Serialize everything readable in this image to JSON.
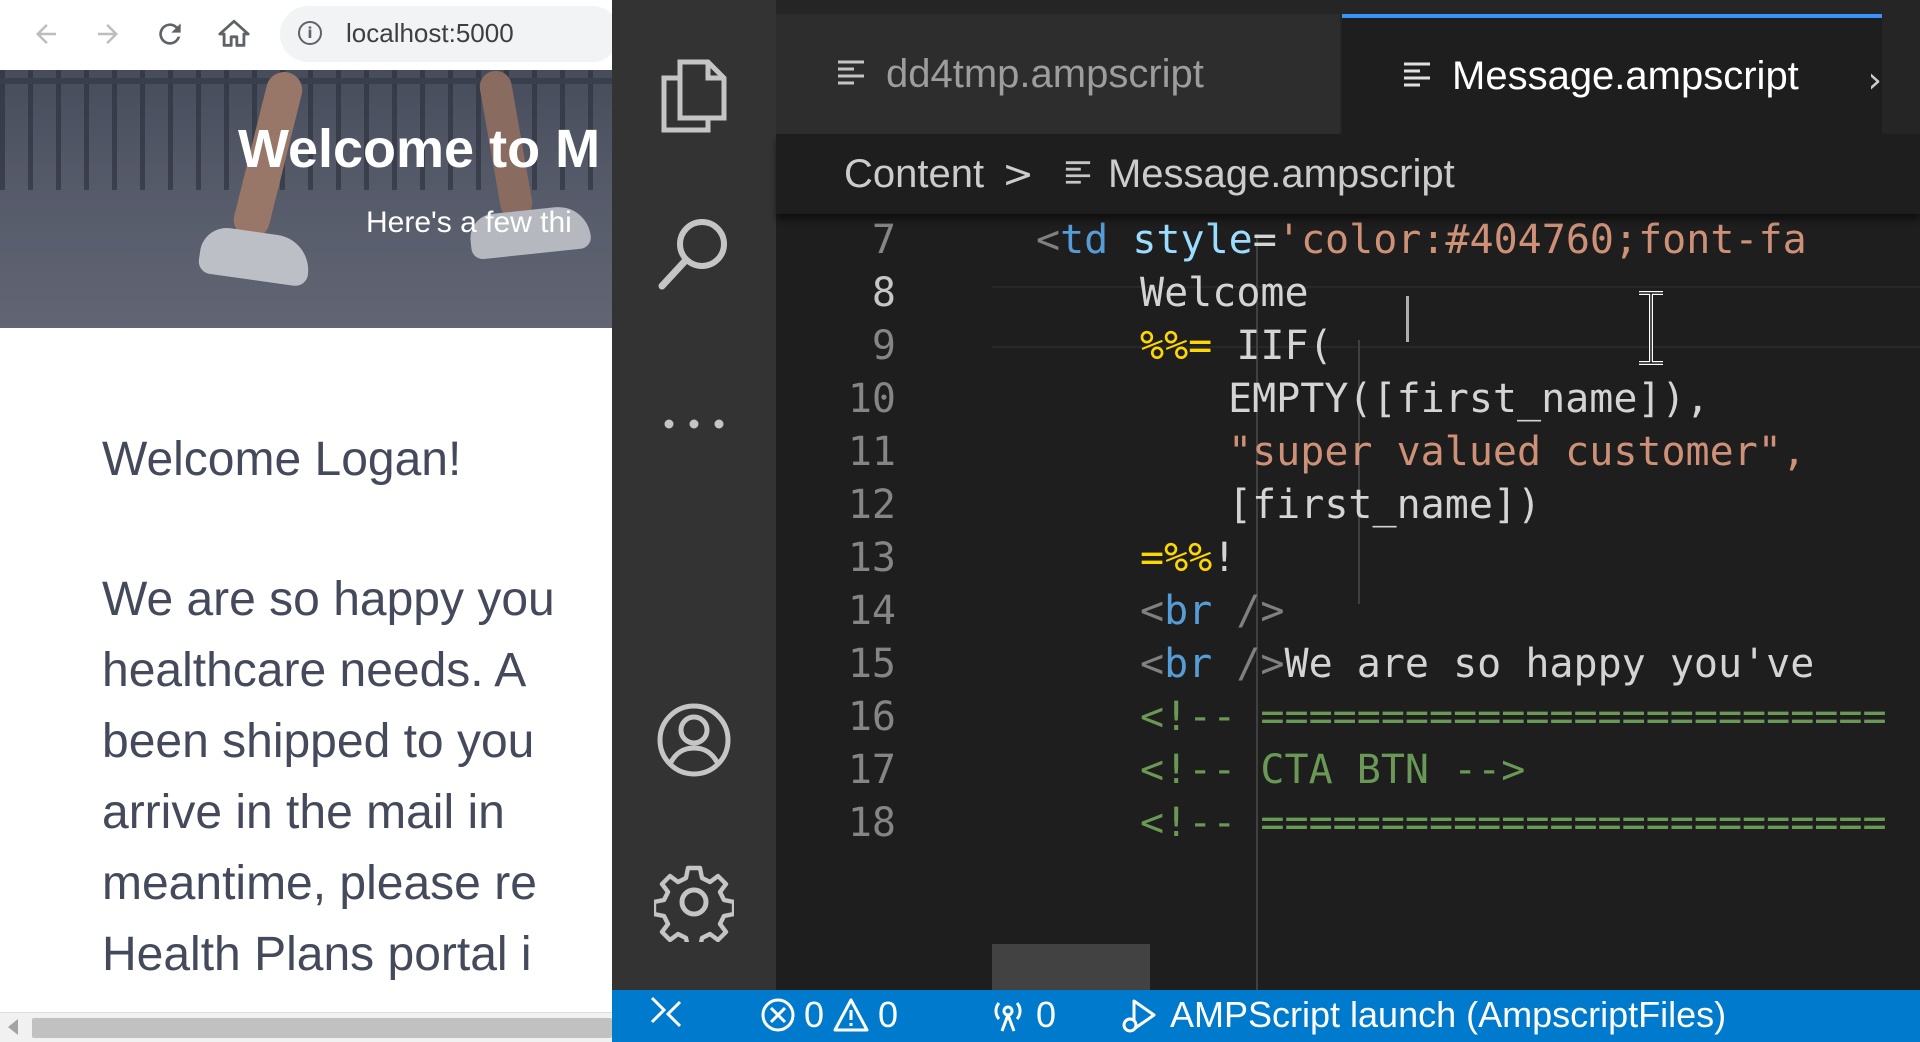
{
  "browser": {
    "url": "localhost:5000",
    "hero": {
      "title": "Welcome to M",
      "subtitle": "Here's a few thi"
    },
    "greeting": "Welcome Logan!",
    "body_lines": [
      "We are so happy you",
      "healthcare needs. A",
      "been shipped to you",
      "arrive in the mail in",
      "meantime, please re",
      "Health Plans portal i"
    ]
  },
  "vscode": {
    "tabs": [
      {
        "label": "dd4tmp.ampscript",
        "active": false
      },
      {
        "label": "Message.ampscript",
        "active": true
      }
    ],
    "tab_close": "›",
    "tab_actions": "⋮",
    "breadcrumb": {
      "folder": "Content",
      "separator": ">",
      "file": "Message.ampscript"
    },
    "editor": {
      "active_line": 8,
      "line_numbers": [
        "7",
        "8",
        "9",
        "10",
        "11",
        "12",
        "13",
        "14",
        "15",
        "16",
        "17",
        "18"
      ],
      "lines": [
        [
          {
            "t": "<",
            "c": "tk-punc"
          },
          {
            "t": "td",
            "c": "tk-tag"
          },
          {
            "t": " style",
            "c": "tk-attr"
          },
          {
            "t": "=",
            "c": "tk-txt"
          },
          {
            "t": "'color:#404760;font-fa",
            "c": "tk-str"
          }
        ],
        [
          {
            "t": "Welcome ",
            "c": "tk-txt"
          }
        ],
        [
          {
            "t": "%%=",
            "c": "tk-amp2"
          },
          {
            "t": " IIF(",
            "c": "tk-txt"
          }
        ],
        [
          {
            "t": "EMPTY([first_name]),",
            "c": "tk-txt"
          }
        ],
        [
          {
            "t": "\"super valued customer\",",
            "c": "tk-str"
          }
        ],
        [
          {
            "t": "[first_name])",
            "c": "tk-txt"
          }
        ],
        [
          {
            "t": "=%%",
            "c": "tk-amp2"
          },
          {
            "t": "!",
            "c": "tk-txt"
          }
        ],
        [
          {
            "t": "<",
            "c": "tk-punc"
          },
          {
            "t": "br",
            "c": "tk-tag"
          },
          {
            "t": " />",
            "c": "tk-punc"
          }
        ],
        [
          {
            "t": "<",
            "c": "tk-punc"
          },
          {
            "t": "br",
            "c": "tk-tag"
          },
          {
            "t": " />",
            "c": "tk-punc"
          },
          {
            "t": "We are so happy you've",
            "c": "tk-txt"
          }
        ],
        [
          {
            "t": "<!-- ==========================",
            "c": "tk-com"
          }
        ],
        [
          {
            "t": "<!-- CTA BTN -->",
            "c": "tk-com"
          }
        ],
        [
          {
            "t": "<!-- ==========================",
            "c": "tk-com"
          }
        ]
      ]
    },
    "status_bar": {
      "remote_icon": "remote-icon",
      "errors": "0",
      "warnings": "0",
      "ports": "0",
      "launch": "AMPScript launch (AmpscriptFiles)"
    },
    "colors": {
      "status_bar": "#007acc",
      "active_tab_border": "#3794ff",
      "activity_bar": "#333333"
    }
  }
}
